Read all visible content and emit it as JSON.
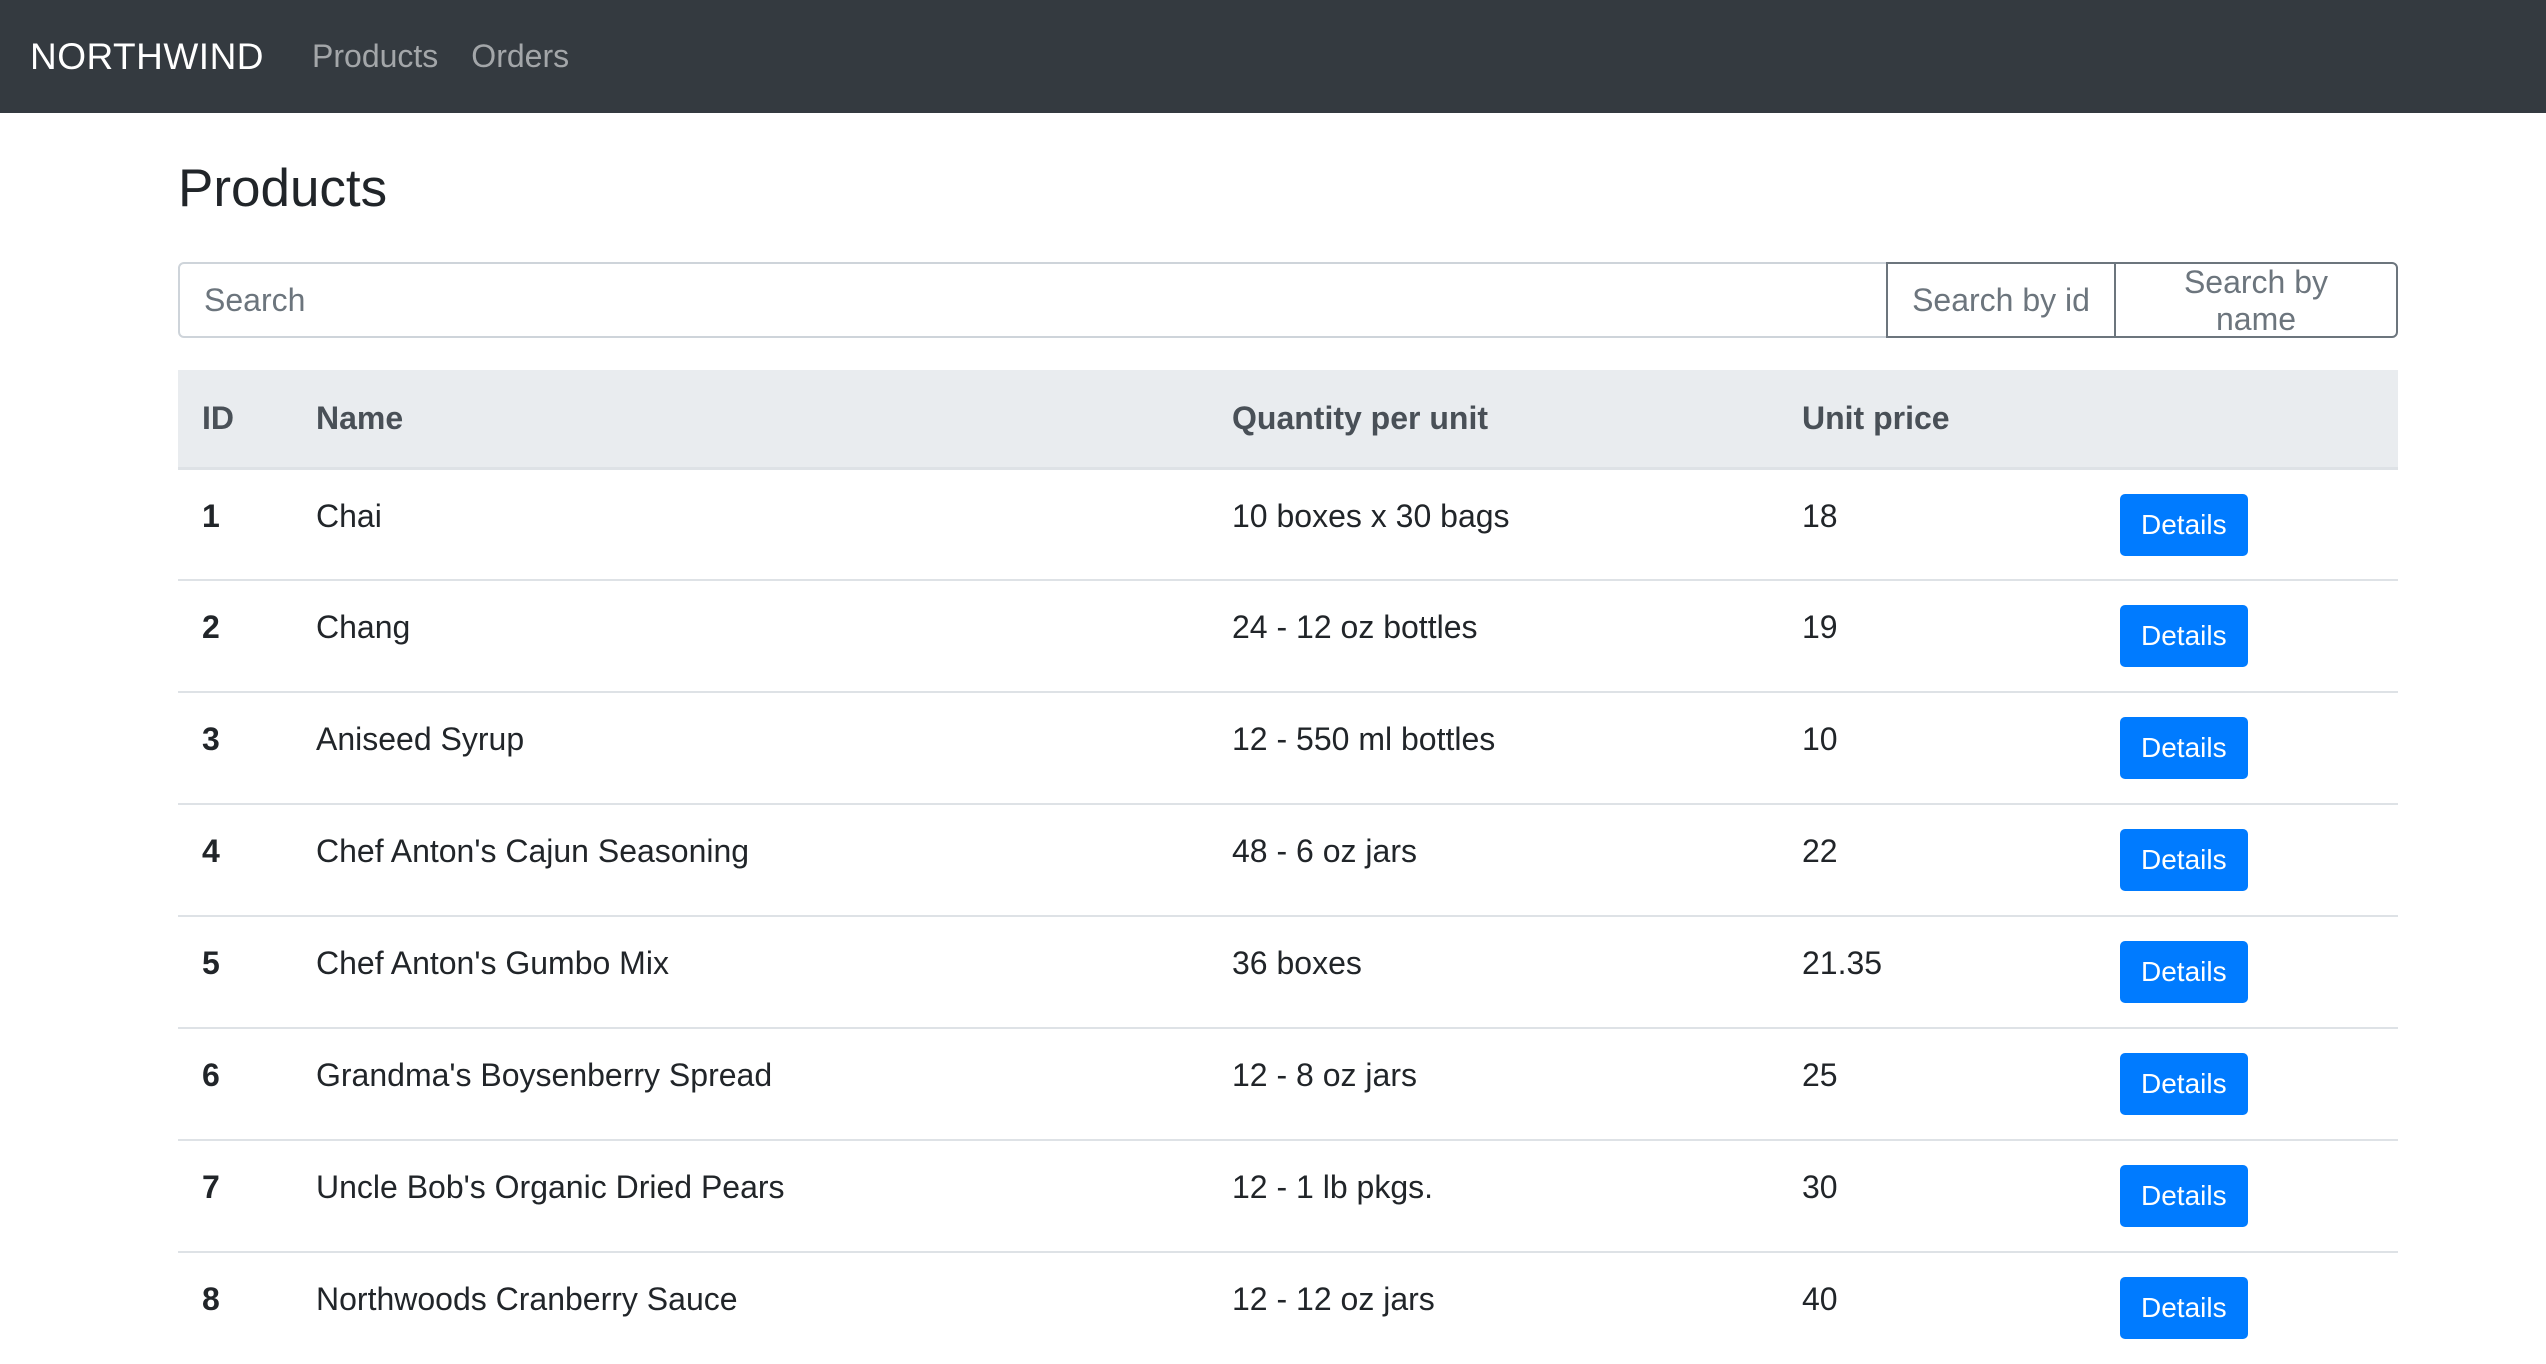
{
  "navbar": {
    "brand": "NORTHWIND",
    "links": [
      "Products",
      "Orders"
    ]
  },
  "page": {
    "title": "Products"
  },
  "search": {
    "placeholder": "Search",
    "by_id_label": "Search by id",
    "by_name_label": "Search by name"
  },
  "table": {
    "headers": [
      "ID",
      "Name",
      "Quantity per unit",
      "Unit price",
      ""
    ],
    "action_label": "Details",
    "rows": [
      {
        "id": "1",
        "name": "Chai",
        "qty": "10 boxes x 30 bags",
        "price": "18"
      },
      {
        "id": "2",
        "name": "Chang",
        "qty": "24 - 12 oz bottles",
        "price": "19"
      },
      {
        "id": "3",
        "name": "Aniseed Syrup",
        "qty": "12 - 550 ml bottles",
        "price": "10"
      },
      {
        "id": "4",
        "name": "Chef Anton's Cajun Seasoning",
        "qty": "48 - 6 oz jars",
        "price": "22"
      },
      {
        "id": "5",
        "name": "Chef Anton's Gumbo Mix",
        "qty": "36 boxes",
        "price": "21.35"
      },
      {
        "id": "6",
        "name": "Grandma's Boysenberry Spread",
        "qty": "12 - 8 oz jars",
        "price": "25"
      },
      {
        "id": "7",
        "name": "Uncle Bob's Organic Dried Pears",
        "qty": "12 - 1 lb pkgs.",
        "price": "30"
      },
      {
        "id": "8",
        "name": "Northwoods Cranberry Sauce",
        "qty": "12 - 12 oz jars",
        "price": "40"
      }
    ]
  },
  "colors": {
    "navbar_bg": "#343a40",
    "primary": "#007bff",
    "table_header_bg": "#e9ecef"
  }
}
